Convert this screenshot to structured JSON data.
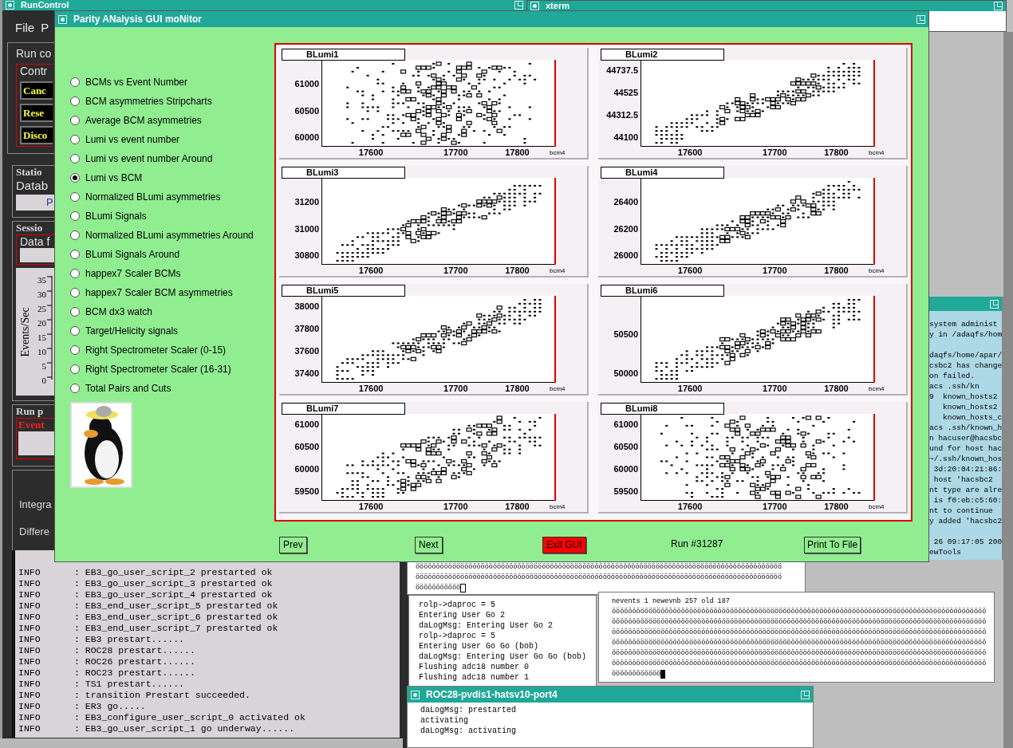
{
  "run_control": {
    "title": "RunControl",
    "menu": [
      "File",
      "P"
    ],
    "group_label": "Run co",
    "control_label": "Contr",
    "buttons": [
      "Canc",
      "Rese",
      "Disco"
    ],
    "station_label": "Statio",
    "database_label": "Datab",
    "database_value": "P",
    "session_label": "Sessio",
    "data_label": "Data f",
    "rate_axis": {
      "ylabel": "Events/Sec",
      "ticks": [
        "35",
        "30",
        "25",
        "20",
        "15",
        "10",
        "5",
        "0"
      ]
    },
    "run_label": "Run p",
    "event_label": "Event",
    "integral_label": "Integra",
    "differential_label": "Differe",
    "log": [
      {
        "level": "INFO",
        "message": ": EB3_go_user_script_2 prestarted ok"
      },
      {
        "level": "INFO",
        "message": ": EB3_go_user_script_3 prestarted ok"
      },
      {
        "level": "INFO",
        "message": ": EB3_go_user_script_4 prestarted ok"
      },
      {
        "level": "INFO",
        "message": ": EB3_end_user_script_5 prestarted ok"
      },
      {
        "level": "INFO",
        "message": ": EB3_end_user_script_6 prestarted ok"
      },
      {
        "level": "INFO",
        "message": ": EB3_end_user_script_7 prestarted ok"
      },
      {
        "level": "INFO",
        "message": ": EB3 prestart......"
      },
      {
        "level": "INFO",
        "message": ": ROC28 prestart......"
      },
      {
        "level": "INFO",
        "message": ": ROC26 prestart......"
      },
      {
        "level": "INFO",
        "message": ": ROC23 prestart......"
      },
      {
        "level": "INFO",
        "message": ": TS1 prestart......"
      },
      {
        "level": "INFO",
        "message": ": transition Prestart succeeded."
      },
      {
        "level": "INFO",
        "message": ": ER3 go....."
      },
      {
        "level": "INFO",
        "message": ": EB3_configure_user_script_0 activated ok"
      },
      {
        "level": "INFO",
        "message": ": EB3_go_user_script_1 go underway......"
      }
    ]
  },
  "xterm_top": {
    "title": "xterm"
  },
  "xterm_right": {
    "blocks": [
      [
        "system administ",
        "y in /adaqfs/hom"
      ],
      [
        "daqfs/home/apar/",
        "csbc2 has change",
        "on failed.",
        "acs .ssh/kn",
        "9  known_hosts2",
        "   known_hosts2",
        "   known_hosts_c",
        "acs .ssh/known_h",
        "n hacuser@hacsbc",
        "und for host hac",
        "~/.ssh/known_hos",
        " 3d:20:04:21:86:",
        " host 'hacsbc2",
        "nt type are alre",
        " is f0:eb:c5:60:",
        "nt to continue",
        "y added 'hacsbc2"
      ],
      [
        " 26 09:17:05 200",
        "ewTools"
      ]
    ]
  },
  "monitor": {
    "title": "Parity ANalysis GUI moNitor",
    "options": [
      {
        "label": "BCMs vs Event Number",
        "selected": false
      },
      {
        "label": "BCM asymmetries Stripcharts",
        "selected": false
      },
      {
        "label": "Average BCM asymmetries",
        "selected": false
      },
      {
        "label": "Lumi vs event number",
        "selected": false
      },
      {
        "label": "Lumi vs event number Around",
        "selected": false
      },
      {
        "label": "Lumi vs BCM",
        "selected": true
      },
      {
        "label": "Normalized BLumi asymmetries",
        "selected": false
      },
      {
        "label": "BLumi Signals",
        "selected": false
      },
      {
        "label": "Normalized BLumi asymmetries Around",
        "selected": false
      },
      {
        "label": "BLumi Signals Around",
        "selected": false
      },
      {
        "label": "happex7 Scaler BCMs",
        "selected": false
      },
      {
        "label": "happex7 Scaler BCM asymmetries",
        "selected": false
      },
      {
        "label": "BCM dx3 watch",
        "selected": false
      },
      {
        "label": "Target/Helicity signals",
        "selected": false
      },
      {
        "label": "Right Spectrometer Scaler (0-15)",
        "selected": false
      },
      {
        "label": "Right Spectrometer Scaler (16-31)",
        "selected": false
      },
      {
        "label": "Total Pairs and Cuts",
        "selected": false
      }
    ],
    "plots": [
      {
        "title": "BLumi1",
        "kind": "cloud",
        "yticks": [
          "61000",
          "60500",
          "60000"
        ],
        "xticks": [
          "17600",
          "17700",
          "17800"
        ],
        "xlabel": "bcm4"
      },
      {
        "title": "BLumi2",
        "kind": "band",
        "yticks": [
          "44737.5",
          "44525",
          "44312.5",
          "44100"
        ],
        "xticks": [
          "17600",
          "17700",
          "17800"
        ],
        "xlabel": "bcm4"
      },
      {
        "title": "BLumi3",
        "kind": "band",
        "yticks": [
          "31200",
          "31000",
          "30800"
        ],
        "xticks": [
          "17600",
          "17700",
          "17800"
        ],
        "xlabel": "bcm4"
      },
      {
        "title": "BLumi4",
        "kind": "band",
        "yticks": [
          "26400",
          "26200",
          "26000"
        ],
        "xticks": [
          "17600",
          "17700",
          "17800"
        ],
        "xlabel": "bcm4"
      },
      {
        "title": "BLumi5",
        "kind": "band",
        "yticks": [
          "38000",
          "37800",
          "37600",
          "37400"
        ],
        "xticks": [
          "17600",
          "17700",
          "17800"
        ],
        "xlabel": "bcm4"
      },
      {
        "title": "BLumi6",
        "kind": "band",
        "yticks": [
          "50500",
          "50000"
        ],
        "xticks": [
          "17600",
          "17700",
          "17800"
        ],
        "xlabel": "bcm4"
      },
      {
        "title": "BLumi7",
        "kind": "wide",
        "yticks": [
          "61000",
          "60500",
          "60000",
          "59500"
        ],
        "xticks": [
          "17600",
          "17700",
          "17800"
        ],
        "xlabel": "bcm4"
      },
      {
        "title": "BLumi8",
        "kind": "cloud",
        "yticks": [
          "61000",
          "60500",
          "60000",
          "59500"
        ],
        "xticks": [
          "17600",
          "17700",
          "17800"
        ],
        "xlabel": "bcm4"
      }
    ],
    "buttons": [
      {
        "label": "Prev",
        "kind": "normal"
      },
      {
        "label": "Next",
        "kind": "normal"
      },
      {
        "label": "Exit GUI",
        "kind": "danger"
      }
    ],
    "run_number": "Run #31287",
    "print_button": "Print To File"
  },
  "terminal_a": {
    "lines": [
      "öööööööööööööööööööööööööööööööööööööööööööööööööööööööööööööööööööööööööööööööööööööööööö",
      "öööööööööööööööööööööööööööööööööööööööööööööööööööööööööööööööööööööööööööööööööööööööööö",
      "ööööööööööö"
    ]
  },
  "terminal_b": {
    "lines": [
      "rolp->daproc = 5",
      "Entering User Go 2",
      "daLogMsg: Entering User Go 2",
      "rolp->daproc = 5",
      "Entering User Go Go (bob)",
      "daLogMsg: Entering User Go Go (bob)",
      "Flushing adc18 number 0",
      "Flushing adc18 number 1"
    ]
  },
  "terminal_c": {
    "lines": [
      "nevents 1 newevnb 257 old 187",
      "öööööööööööööööööööööööööööööööööööööööööööööööööööööööööööööööööööööööööööööööööööööööööööö",
      "öööööööööööööööööööööööööööööööööööööööööööööööööööööööööööööööööööööööööööööööööööööööööööö",
      "öööööööööööööööööööööööööööööööööööööööööööööööööööööööööööööööööööööööööööööööööööööööööööö",
      "öööööööööööööööööööööööööööööööööööööööööööööööööööööööööööööööööööööööööööööööööööööööööööö",
      "öööööööööööööööööööööööööööööööööööööööööööööööööööööööööööööööööööööööööööööööööööööööööööö",
      "öööööööööööööööööööööööööööööööööööööööööööööööööööööööööööööööööööööööööööööööööööööööööööö",
      "öööööööööööö"
    ]
  },
  "roc_window": {
    "title": "ROC28-pvdis1-hatsv10-port4",
    "lines": [
      "daLogMsg: prestarted",
      "activating",
      "daLogMsg: activating"
    ]
  }
}
